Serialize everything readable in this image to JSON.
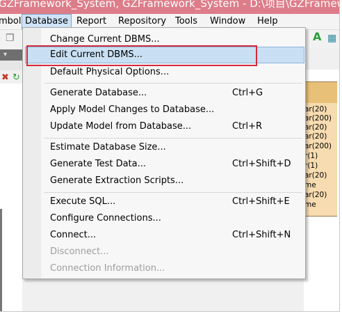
{
  "window": {
    "title": "GZFramework_System, GZFramework_System - D:\\项目\\GZFramework"
  },
  "menu_bar": [
    {
      "label": "mbol"
    },
    {
      "label": "Database"
    },
    {
      "label": "Report"
    },
    {
      "label": "Repository"
    },
    {
      "label": "Tools"
    },
    {
      "label": "Window"
    },
    {
      "label": "Help"
    }
  ],
  "database_menu": [
    {
      "label": "Change Current DBMS...",
      "shortcut": ""
    },
    {
      "label": "Edit Current DBMS...",
      "shortcut": ""
    },
    {
      "label": "Default Physical Options...",
      "shortcut": ""
    },
    {
      "label": "Generate Database...",
      "shortcut": "Ctrl+G"
    },
    {
      "label": "Apply Model Changes to Database...",
      "shortcut": ""
    },
    {
      "label": "Update Model from Database...",
      "shortcut": "Ctrl+R"
    },
    {
      "label": "Estimate Database Size...",
      "shortcut": ""
    },
    {
      "label": "Generate Test Data...",
      "shortcut": "Ctrl+Shift+D"
    },
    {
      "label": "Generate Extraction Scripts...",
      "shortcut": ""
    },
    {
      "label": "Execute SQL...",
      "shortcut": "Ctrl+Shift+E"
    },
    {
      "label": "Configure Connections...",
      "shortcut": ""
    },
    {
      "label": "Connect...",
      "shortcut": "Ctrl+Shift+N"
    },
    {
      "label": "Disconnect...",
      "shortcut": ""
    },
    {
      "label": "Connection Information...",
      "shortcut": ""
    }
  ],
  "entity_rows": [
    "ar(20)",
    "ar(200)",
    "ar(20)",
    "ar(20)",
    "ar(200)",
    "r(1)",
    "r(1)",
    "ar(20)",
    "me",
    "ar(20)",
    "me"
  ],
  "colors": {
    "title_bar": "#dd7d89",
    "menu_highlight": "#c9e0f4",
    "annotation_box": "#d42a3b",
    "entity_fill": "#f6dcb0"
  }
}
